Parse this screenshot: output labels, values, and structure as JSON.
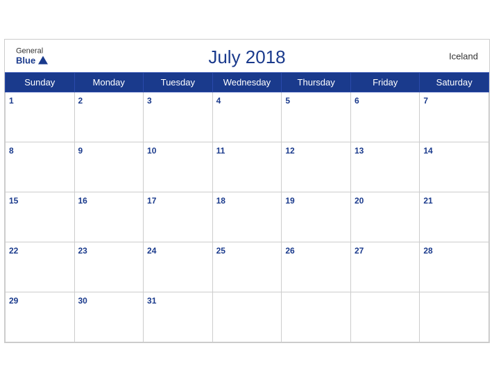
{
  "calendar": {
    "title": "July 2018",
    "country": "Iceland",
    "logo": {
      "general": "General",
      "blue": "Blue"
    },
    "days_of_week": [
      "Sunday",
      "Monday",
      "Tuesday",
      "Wednesday",
      "Thursday",
      "Friday",
      "Saturday"
    ],
    "weeks": [
      [
        1,
        2,
        3,
        4,
        5,
        6,
        7
      ],
      [
        8,
        9,
        10,
        11,
        12,
        13,
        14
      ],
      [
        15,
        16,
        17,
        18,
        19,
        20,
        21
      ],
      [
        22,
        23,
        24,
        25,
        26,
        27,
        28
      ],
      [
        29,
        30,
        31,
        null,
        null,
        null,
        null
      ]
    ]
  }
}
